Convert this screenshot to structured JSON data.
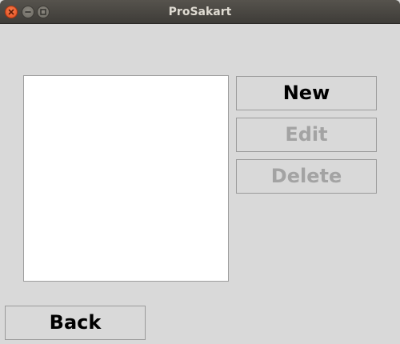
{
  "window": {
    "title": "ProSakart",
    "controls": [
      "close-icon",
      "minimize-icon",
      "maximize-icon"
    ]
  },
  "list": {
    "items": []
  },
  "buttons": {
    "new": {
      "label": "New",
      "enabled": true
    },
    "edit": {
      "label": "Edit",
      "enabled": false
    },
    "delete": {
      "label": "Delete",
      "enabled": false
    },
    "back": {
      "label": "Back",
      "enabled": true
    }
  },
  "colors": {
    "titlebar": "#47453f",
    "background": "#d9d9d9",
    "close_button": "#e95420",
    "disabled_text": "#a3a3a3"
  }
}
